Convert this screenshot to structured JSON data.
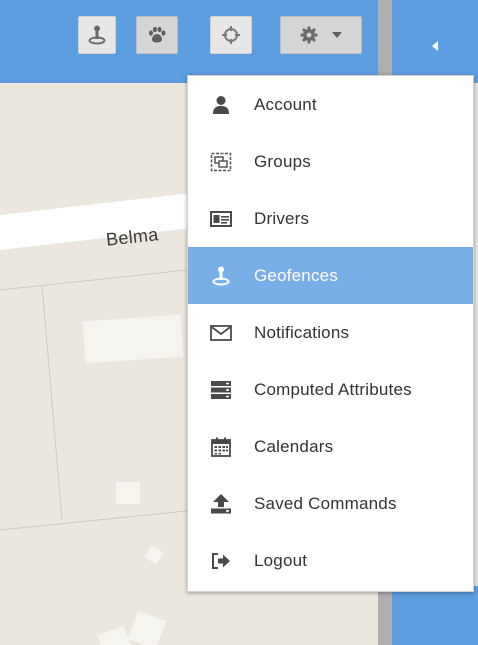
{
  "map": {
    "street_label": "Belma"
  },
  "toolbar": {
    "buttons": [
      {
        "name": "geofence-toolbar-button",
        "icon": "geofence-pin-icon"
      },
      {
        "name": "paw-toolbar-button",
        "icon": "paw-icon"
      },
      {
        "name": "crosshair-toolbar-button",
        "icon": "crosshair-icon"
      },
      {
        "name": "settings-dropdown-button",
        "icon": "gear-icon",
        "caret": "caret-down-icon"
      }
    ]
  },
  "settings_menu": {
    "items": [
      {
        "label": "Account",
        "icon": "user-icon"
      },
      {
        "label": "Groups",
        "icon": "groups-icon"
      },
      {
        "label": "Drivers",
        "icon": "id-card-icon"
      },
      {
        "label": "Geofences",
        "icon": "geofence-pin-icon",
        "active": true
      },
      {
        "label": "Notifications",
        "icon": "envelope-icon"
      },
      {
        "label": "Computed Attributes",
        "icon": "server-icon"
      },
      {
        "label": "Calendars",
        "icon": "calendar-icon"
      },
      {
        "label": "Saved Commands",
        "icon": "upload-icon"
      },
      {
        "label": "Logout",
        "icon": "sign-out-icon"
      }
    ]
  },
  "colors": {
    "toolbar": "#5d9ee0",
    "active_item": "#7aaee6",
    "map_background": "#ebe7de"
  }
}
